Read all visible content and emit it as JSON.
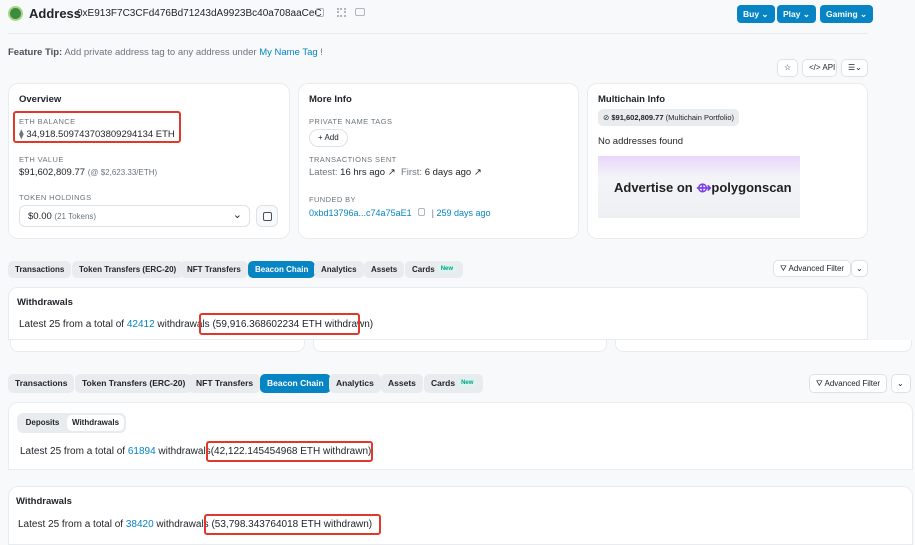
{
  "header": {
    "title": "Address",
    "address": "0xE913F7C3CFd476Bd71243dA9923Bc40a708aaCeC",
    "buttons": [
      "Buy",
      "Play",
      "Gaming"
    ]
  },
  "feature_tip": {
    "prefix": "Feature Tip:",
    "text": " Add private address tag to any address under ",
    "link": "My Name Tag",
    "suffix": " !"
  },
  "toolbar": {
    "api_label": "API"
  },
  "overview": {
    "title": "Overview",
    "balance_label": "ETH BALANCE",
    "balance_value": "34,918.509743703809294134 ETH",
    "value_label": "ETH VALUE",
    "value_amount": "$91,602,809.77",
    "value_rate": "(@ $2,623.33/ETH)",
    "holdings_label": "TOKEN HOLDINGS",
    "holdings_value": "$0.00",
    "holdings_count": "(21 Tokens)"
  },
  "more_info": {
    "title": "More Info",
    "tags_label": "PRIVATE NAME TAGS",
    "add_label": "+ Add",
    "tx_label": "TRANSACTIONS SENT",
    "latest_prefix": "Latest:",
    "latest_value": "16 hrs ago",
    "first_prefix": "First:",
    "first_value": "6 days ago",
    "funded_label": "FUNDED BY",
    "funded_addr": "0xbd13796a...c74a75aE1",
    "funded_age": "259 days ago"
  },
  "multichain": {
    "title": "Multichain Info",
    "portfolio_amount": "$91,602,809.77",
    "portfolio_label": "(Multichain Portfolio)",
    "no_addresses": "No addresses found",
    "ad_text": "Advertise on",
    "ad_brand": "polygonscan"
  },
  "tabs1": {
    "items": [
      "Transactions",
      "Token Transfers (ERC-20)",
      "NFT Transfers",
      "Beacon Chain",
      "Analytics",
      "Assets",
      "Cards"
    ],
    "new_badge": "New",
    "filter": "Advanced Filter"
  },
  "panel1": {
    "title": "Withdrawals",
    "prefix": "Latest 25 from a total of ",
    "count": "42412",
    "mid": " withdrawals ",
    "amount": "(59,916.368602234 ETH withdrawn)"
  },
  "tabs2": {
    "items": [
      "Transactions",
      "Token Transfers (ERC-20)",
      "NFT Transfers",
      "Beacon Chain",
      "Analytics",
      "Assets",
      "Cards"
    ],
    "new_badge": "New",
    "filter": "Advanced Filter"
  },
  "panel2": {
    "subtabs": [
      "Deposits",
      "Withdrawals"
    ],
    "prefix": "Latest 25 from a total of ",
    "count": "61894",
    "mid": " withdrawals",
    "amount": "(42,122.145454968 ETH withdrawn)"
  },
  "panel3": {
    "title": "Withdrawals",
    "prefix": "Latest 25 from a total of ",
    "count": "38420",
    "mid": " withdrawals ",
    "amount": "(53,798.343764018 ETH withdrawn)"
  }
}
